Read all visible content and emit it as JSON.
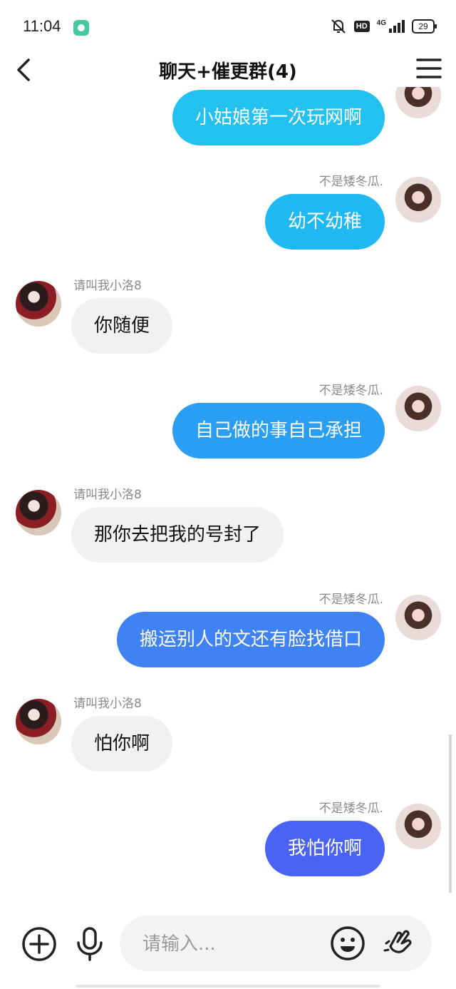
{
  "status_bar": {
    "time": "11:04",
    "network": "4G",
    "hd": "HD",
    "battery": "29"
  },
  "header": {
    "title": "聊天+催更群(4)"
  },
  "colors": {
    "accent_start": "#1fc4f2",
    "accent_end": "#4a63f5",
    "other_bubble": "#f1f1f1"
  },
  "messages": [
    {
      "side": "mine",
      "sender": "",
      "text": "小姑娘第一次玩网啊",
      "color": "#22c1f0"
    },
    {
      "side": "mine",
      "sender": "不是矮冬瓜.",
      "text": "幼不幼稚",
      "color": "#20b8f2"
    },
    {
      "side": "other",
      "sender": "请叫我小洛8",
      "text": "你随便"
    },
    {
      "side": "mine",
      "sender": "不是矮冬瓜.",
      "text": "自己做的事自己承担",
      "color": "#2a9ef3"
    },
    {
      "side": "other",
      "sender": "请叫我小洛8",
      "text": "那你去把我的号封了"
    },
    {
      "side": "mine",
      "sender": "不是矮冬瓜.",
      "text": "搬运别人的文还有脸找借口",
      "color": "#3e82f4"
    },
    {
      "side": "other",
      "sender": "请叫我小洛8",
      "text": "怕你啊"
    },
    {
      "side": "mine",
      "sender": "不是矮冬瓜.",
      "text": "我怕你啊",
      "color": "#4a63f5"
    }
  ],
  "input": {
    "placeholder": "请输入..."
  }
}
